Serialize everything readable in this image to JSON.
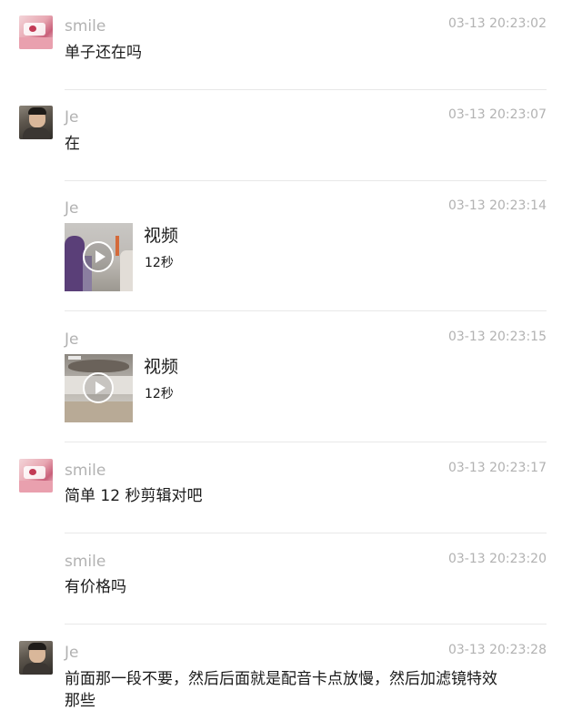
{
  "messages": [
    {
      "sender": "smile",
      "time": "03-13 20:23:02",
      "text": "单子还在吗",
      "avatar": "pink-avatar"
    },
    {
      "sender": "Je",
      "time": "03-13 20:23:07",
      "text": "在",
      "avatar": "dark-avatar"
    },
    {
      "sender": "Je",
      "time": "03-13 20:23:14",
      "video_title": "视频",
      "video_duration": "12秒"
    },
    {
      "sender": "Je",
      "time": "03-13 20:23:15",
      "video_title": "视频",
      "video_duration": "12秒"
    },
    {
      "sender": "smile",
      "time": "03-13 20:23:17",
      "text": "简单 12 秒剪辑对吧",
      "avatar": "pink-avatar"
    },
    {
      "sender": "smile",
      "time": "03-13 20:23:20",
      "text": "有价格吗"
    },
    {
      "sender": "Je",
      "time": "03-13 20:23:28",
      "text_line1": "前面那一段不要，然后后面就是配音卡点放慢，然后加滤镜特效",
      "text_line2": "那些",
      "avatar": "dark-avatar"
    }
  ],
  "colors": {
    "meta_text": "#b2b2b2",
    "body_text": "#1a1a1a",
    "divider": "#e8e8e8"
  },
  "icons": {
    "video_play": "play-circle-icon"
  }
}
